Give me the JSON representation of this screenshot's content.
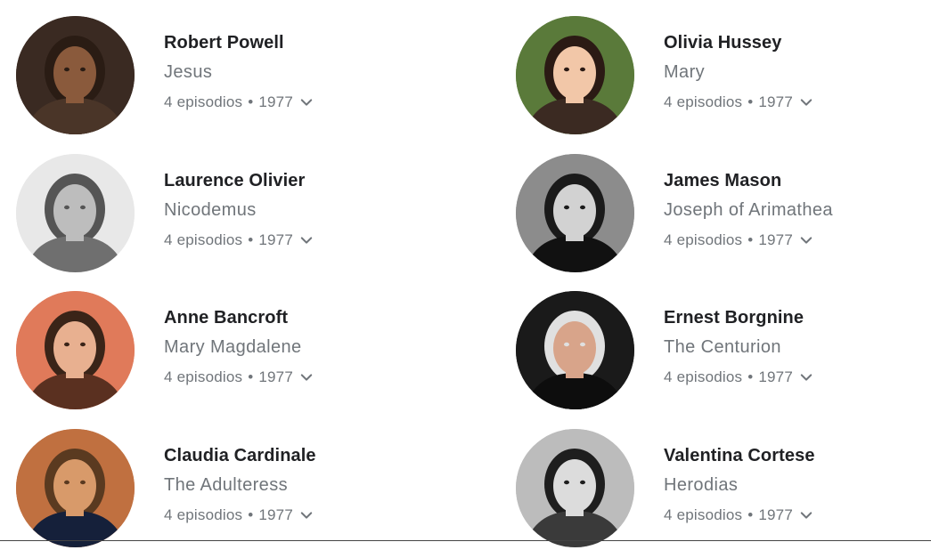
{
  "cast": [
    {
      "name": "Robert Powell",
      "character": "Jesus",
      "episodes": "4 episodios",
      "separator": "•",
      "year": "1977",
      "avatar_icon": "actor-portrait",
      "colors": {
        "bg": "#3a2a22",
        "skin": "#8a5a3c",
        "hair": "#2a1c14",
        "clothes": "#4a3528"
      }
    },
    {
      "name": "Olivia Hussey",
      "character": "Mary",
      "episodes": "4 episodios",
      "separator": "•",
      "year": "1977",
      "avatar_icon": "actor-portrait",
      "colors": {
        "bg": "#5a7a3a",
        "skin": "#f2c7a8",
        "hair": "#2b1a14",
        "clothes": "#3b2a22"
      }
    },
    {
      "name": "Laurence Olivier",
      "character": "Nicodemus",
      "episodes": "4 episodios",
      "separator": "•",
      "year": "1977",
      "avatar_icon": "actor-portrait",
      "colors": {
        "bg": "#e8e8e8",
        "skin": "#bdbdbd",
        "hair": "#555555",
        "clothes": "#6f6f6f"
      }
    },
    {
      "name": "James Mason",
      "character": "Joseph of Arimathea",
      "episodes": "4 episodios",
      "separator": "•",
      "year": "1977",
      "avatar_icon": "actor-portrait",
      "colors": {
        "bg": "#8c8c8c",
        "skin": "#d2d2d2",
        "hair": "#1a1a1a",
        "clothes": "#111111"
      }
    },
    {
      "name": "Anne Bancroft",
      "character": "Mary Magdalene",
      "episodes": "4 episodios",
      "separator": "•",
      "year": "1977",
      "avatar_icon": "actor-portrait",
      "colors": {
        "bg": "#e07a5a",
        "skin": "#e8b090",
        "hair": "#3a2418",
        "clothes": "#5a3020"
      }
    },
    {
      "name": "Ernest Borgnine",
      "character": "The Centurion",
      "episodes": "4 episodios",
      "separator": "•",
      "year": "1977",
      "avatar_icon": "actor-portrait",
      "colors": {
        "bg": "#1a1a1a",
        "skin": "#d8a48a",
        "hair": "#e0e0e0",
        "clothes": "#0d0d0d"
      }
    },
    {
      "name": "Claudia Cardinale",
      "character": "The Adulteress",
      "episodes": "4 episodios",
      "separator": "•",
      "year": "1977",
      "avatar_icon": "actor-portrait",
      "colors": {
        "bg": "#c07040",
        "skin": "#d89a6a",
        "hair": "#5a3a20",
        "clothes": "#15203a"
      }
    },
    {
      "name": "Valentina Cortese",
      "character": "Herodias",
      "episodes": "4 episodios",
      "separator": "•",
      "year": "1977",
      "avatar_icon": "actor-portrait",
      "colors": {
        "bg": "#bcbcbc",
        "skin": "#dcdcdc",
        "hair": "#1e1e1e",
        "clothes": "#3a3a3a"
      }
    }
  ],
  "chevron_icon": "chevron-down-icon",
  "theme": {
    "name_color": "#202124",
    "secondary_color": "#70757a"
  }
}
